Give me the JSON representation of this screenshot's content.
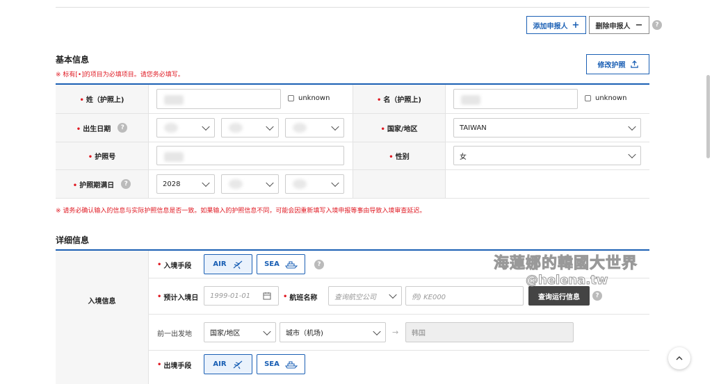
{
  "toolbar": {
    "add_applicant_label": "添加申报人",
    "remove_applicant_label": "删除申报人",
    "help_glyph": "?"
  },
  "basic_info": {
    "title": "基本信息",
    "required_note": "※ 标有[•]的项目为必填项目。请您务必填写。",
    "edit_passport_label": "修改护照",
    "surname_label": "姓（护照上)",
    "given_name_label": "名（护照上)",
    "unknown_label": "unknown",
    "birth_date_label": "出生日期",
    "country_label": "国家/地区",
    "country_value": "TAIWAN",
    "passport_no_label": "护照号",
    "gender_label": "性别",
    "gender_value": "女",
    "passport_expiry_label": "护照期满日",
    "expiry_year_value": "2028",
    "warning_note": "※ 请务必确认输入的信息与实际护照信息是否一致。如果输入的护照信息不同，可能会因重新填写入境申报等事由导致入境审查延迟。"
  },
  "detail_info": {
    "title": "详细信息",
    "entry_info_label": "入境信息",
    "entry_mode_label": "入境手段",
    "air_label": "AIR",
    "sea_label": "SEA",
    "planned_entry_date_label": "预计入境日",
    "date_placeholder": "1999-01-01",
    "flight_name_label": "航班名称",
    "airline_placeholder": "查询航空公司",
    "flight_placeholder": "例) KE000",
    "query_flight_label": "查询运行信息",
    "prev_departure_label": "前一出发地",
    "country_select_value": "国家/地区",
    "city_select_value": "城市（机场)",
    "arrival_country": "韩国",
    "exit_mode_label": "出境手段"
  },
  "watermark": {
    "line1": "海蓮娜的韓國大世界",
    "line2": "@helena.tw"
  },
  "colors": {
    "accent": "#1a5fb4",
    "required": "#e01b24"
  }
}
